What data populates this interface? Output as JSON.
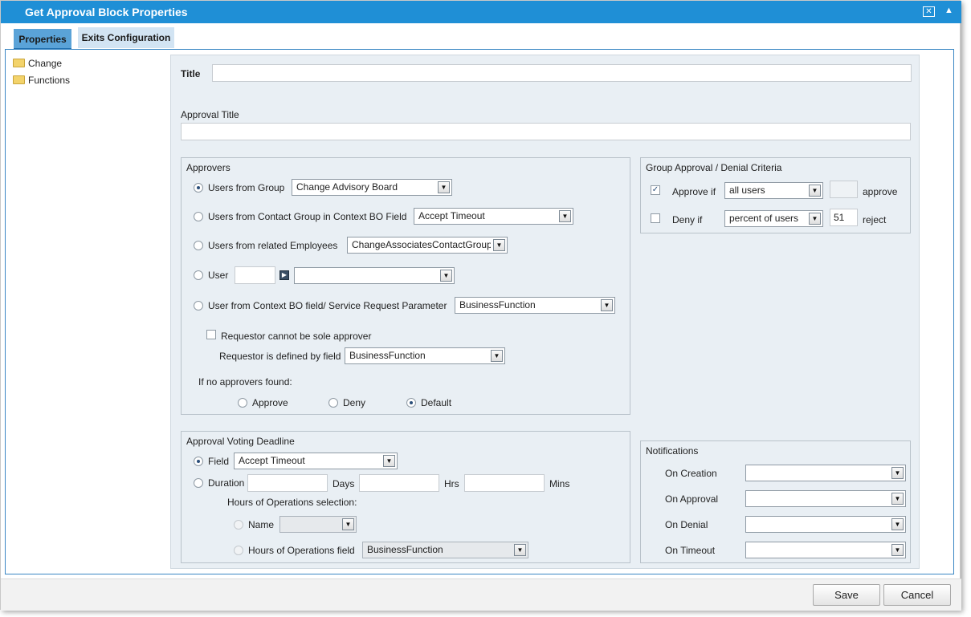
{
  "window": {
    "title": "Get Approval Block Properties",
    "close_icon": "x-box-icon",
    "collapse_icon": "caret-up-icon"
  },
  "tabs": [
    {
      "label": "Properties"
    },
    {
      "label": "Exits Configuration"
    }
  ],
  "tree": [
    {
      "label": "Change"
    },
    {
      "label": "Functions"
    }
  ],
  "form": {
    "title_label": "Title",
    "title_value": "",
    "approval_title_label": "Approval Title",
    "approval_title_value": ""
  },
  "approvers": {
    "legend": "Approvers",
    "users_from_group": {
      "label": "Users from Group",
      "value": "Change Advisory Board"
    },
    "contact_group": {
      "label": "Users from Contact Group in Context BO Field",
      "value": "Accept Timeout"
    },
    "related_employees": {
      "label": "Users from related Employees",
      "value": "ChangeAssociatesContactGroup"
    },
    "user": {
      "label": "User",
      "value": "",
      "select_value": ""
    },
    "context_field": {
      "label": "User from Context BO field/ Service Request Parameter",
      "value": "BusinessFunction"
    },
    "requestor_sole": {
      "label": "Requestor cannot be sole approver"
    },
    "requestor_field": {
      "label": "Requestor is defined by field",
      "value": "BusinessFunction"
    },
    "no_approvers_label": "If no approvers found:",
    "no_approvers_options": [
      "Approve",
      "Deny",
      "Default"
    ]
  },
  "criteria": {
    "legend": "Group Approval / Denial Criteria",
    "approve": {
      "label": "Approve if",
      "value": "all users",
      "count": "",
      "suffix": "approve"
    },
    "deny": {
      "label": "Deny if",
      "value": "percent of users",
      "count": "51",
      "suffix": "reject"
    }
  },
  "deadline": {
    "legend": "Approval Voting Deadline",
    "field": {
      "label": "Field",
      "value": "Accept Timeout"
    },
    "duration": {
      "label": "Duration",
      "days_label": "Days",
      "hrs_label": "Hrs",
      "mins_label": "Mins",
      "days": "",
      "hrs": "",
      "mins": ""
    },
    "hours_ops_label": "Hours of Operations selection:",
    "name": {
      "label": "Name",
      "value": ""
    },
    "hours_field": {
      "label": "Hours of Operations field",
      "value": "BusinessFunction"
    }
  },
  "notifications": {
    "legend": "Notifications",
    "items": [
      {
        "label": "On Creation",
        "value": ""
      },
      {
        "label": "On Approval",
        "value": ""
      },
      {
        "label": "On Denial",
        "value": ""
      },
      {
        "label": "On Timeout",
        "value": ""
      }
    ]
  },
  "footer": {
    "save_label": "Save",
    "cancel_label": "Cancel"
  }
}
